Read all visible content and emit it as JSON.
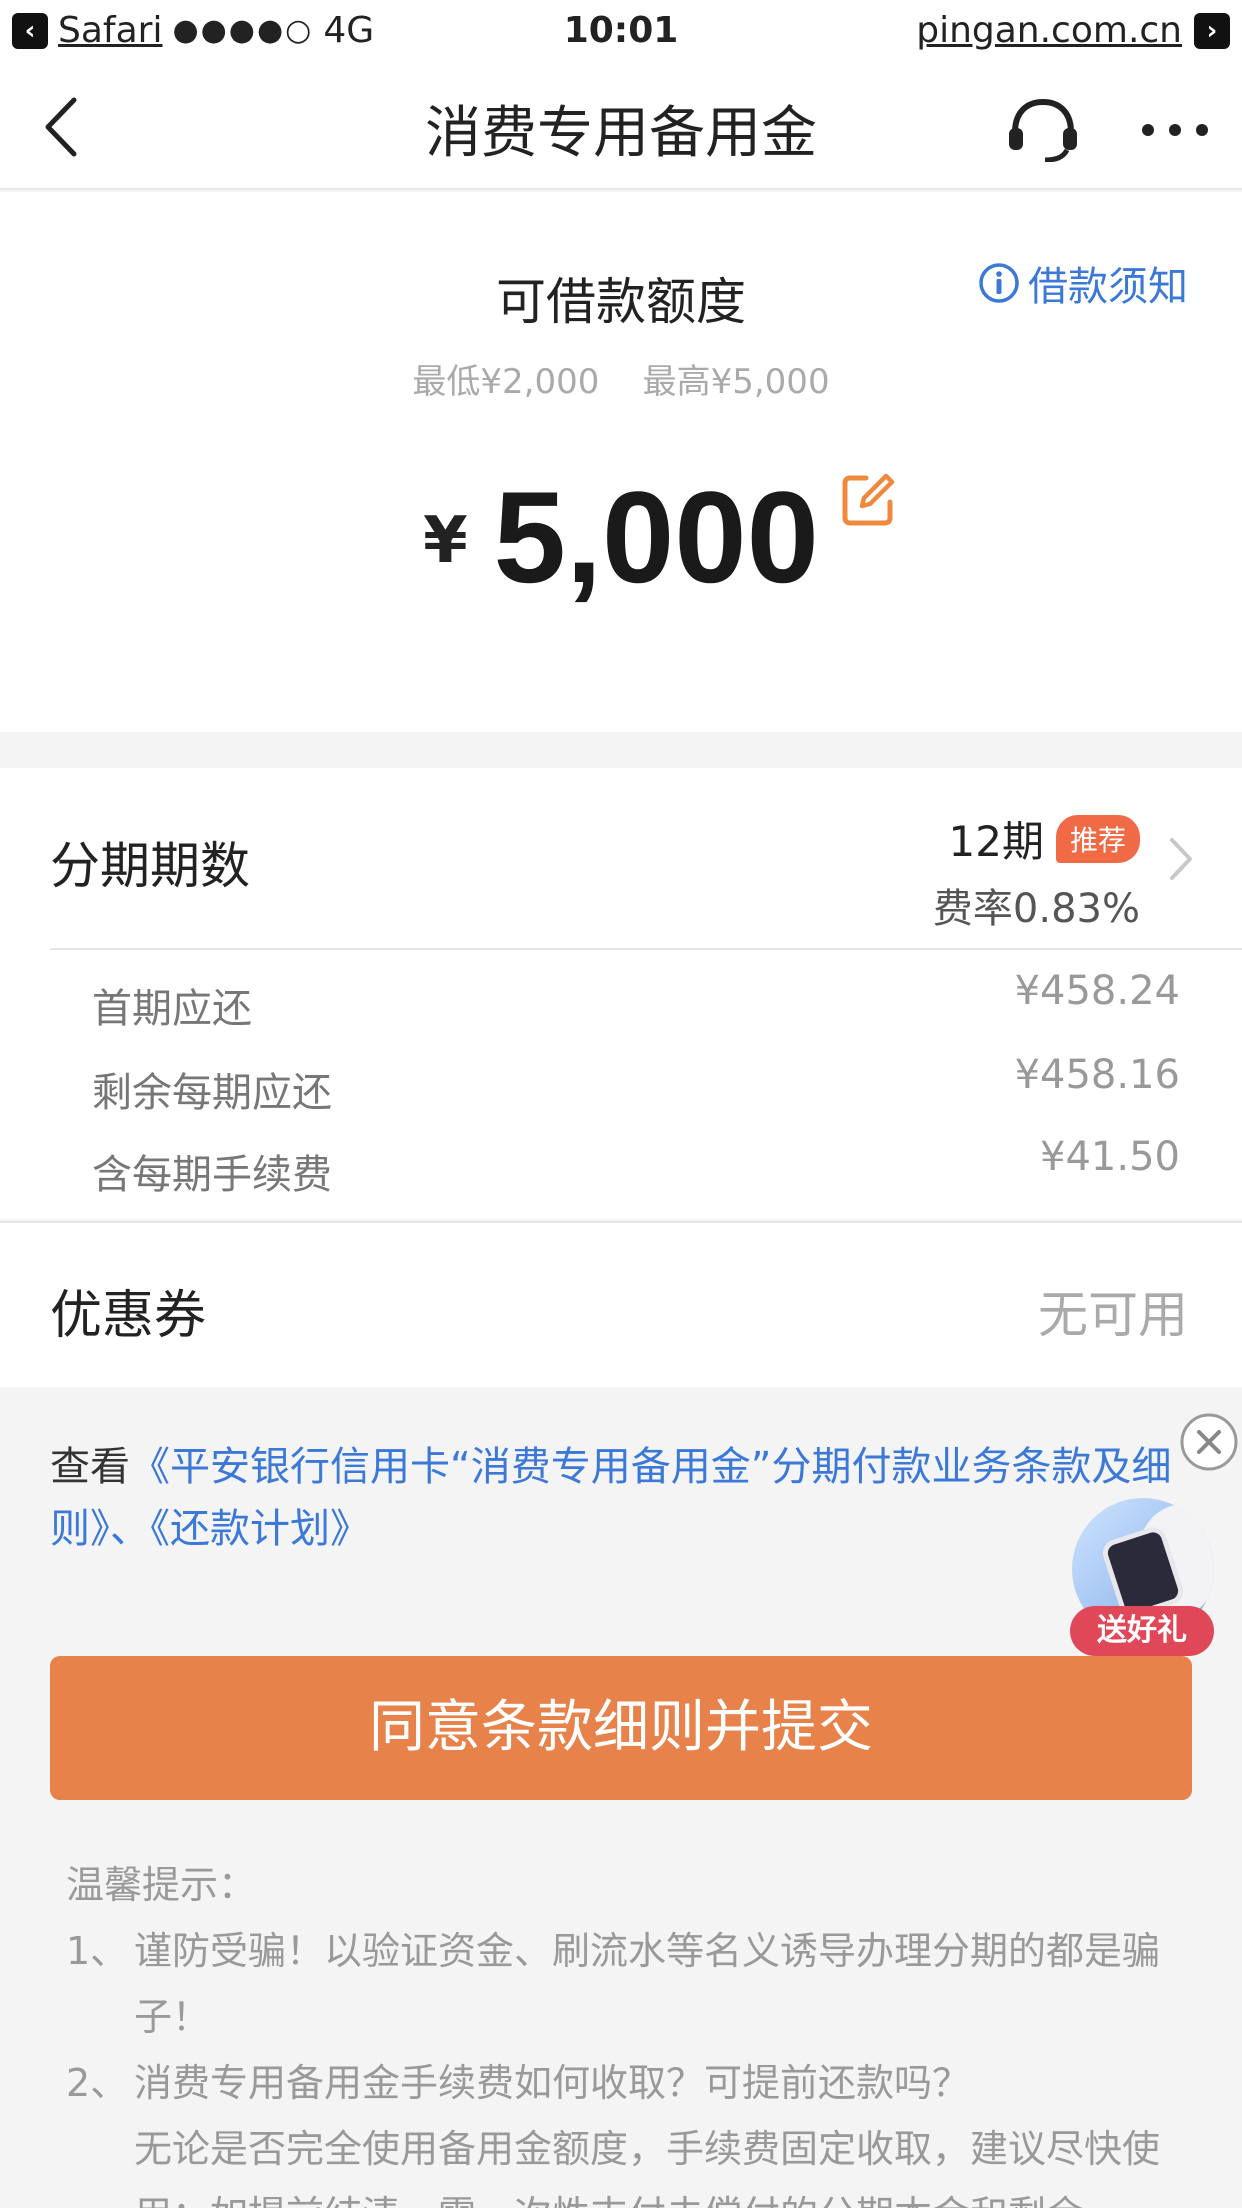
{
  "status_bar": {
    "app": "Safari",
    "signal": "●●●●○",
    "network": "4G",
    "time": "10:01",
    "url": "pingan.com.cn"
  },
  "nav": {
    "title": "消费专用备用金",
    "icons": [
      "back-icon",
      "headset-icon",
      "more-icon"
    ]
  },
  "loan": {
    "label": "可借款额度",
    "notice_link": "借款须知",
    "range": "最低¥2,000    最高¥5,000",
    "currency": "¥",
    "amount": "5,000"
  },
  "installment": {
    "label": "分期期数",
    "periods": "12期",
    "badge": "推荐",
    "rate": "费率0.83%",
    "details": [
      {
        "label": "首期应还",
        "value": "¥458.24"
      },
      {
        "label": "剩余每期应还",
        "value": "¥458.16"
      },
      {
        "label": "含每期手续费",
        "value": "¥41.50"
      }
    ]
  },
  "coupon": {
    "label": "优惠券",
    "value": "无可用"
  },
  "terms": {
    "prefix": "查看",
    "link1": "《平安银行信用卡“消费专用备用金”分期付款业务条款及细则》",
    "separator": "、",
    "link2": "《还款计划》"
  },
  "promo": {
    "label": "送好礼"
  },
  "submit": {
    "label": "同意条款细则并提交"
  },
  "tips": {
    "title": "温馨提示：",
    "items": [
      {
        "num": "1、",
        "text": "谨防受骗！以验证资金、刷流水等名义诱导办理分期的都是骗子！"
      },
      {
        "num": "2、",
        "text": "消费专用备用金手续费如何收取？可提前还款吗？"
      }
    ],
    "item2_detail": "无论是否完全使用备用金额度，手续费固定收取，建议尽快使用；如提前结清，需一次性支付未偿付的分期本金和剩余"
  },
  "colors": {
    "accent": "#e6824a",
    "link": "#3b78d8",
    "badge": "#f06a45",
    "edit_icon": "#f0883e"
  }
}
